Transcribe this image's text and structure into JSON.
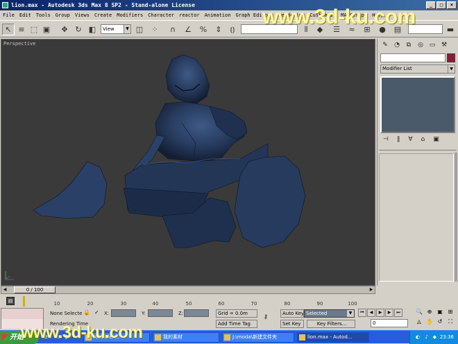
{
  "window": {
    "title": "lion.max - Autodesk 3ds Max 8 SP2 - Stand-alone License",
    "buttons": [
      "_",
      "□",
      "×"
    ]
  },
  "menu": [
    "File",
    "Edit",
    "Tools",
    "Group",
    "Views",
    "Create",
    "Modifiers",
    "Character",
    "reactor",
    "Animation",
    "Graph Editors",
    "Rendering",
    "Customize",
    "MAXScript",
    "Help"
  ],
  "toolbar": {
    "view_dropdown": "View",
    "icons": [
      "select-arrow-icon",
      "select-region-icon",
      "window-crossing-icon",
      "move-icon",
      "rotate-icon",
      "scale-icon",
      "pivot-icon",
      "mirror-icon",
      "align-icon",
      "snap-icon",
      "angle-snap-icon",
      "percent-snap-icon",
      "spinner-snap-icon",
      "named-selection-icon"
    ]
  },
  "viewport": {
    "label": "Perspective",
    "background": "#3a3a3a",
    "model_color": "#2a3a5a"
  },
  "command_panel": {
    "modifier_list": "Modifier List",
    "object_color": "#8c1a3a"
  },
  "time_slider": {
    "position": "0 / 100",
    "current_frame": 0,
    "total_frames": 100
  },
  "trackbar": {
    "ticks": [
      "10",
      "20",
      "30",
      "40",
      "50",
      "60",
      "70",
      "80",
      "90",
      "100"
    ]
  },
  "status": {
    "selection": "None Selecte",
    "rendering": "Rendering Time",
    "x_label": "X:",
    "y_label": "Y:",
    "z_label": "Z:",
    "grid": "Grid = 0.0m",
    "add_time_tag": "Add Time Tag",
    "auto_key": "Auto Key",
    "set_key": "Set Key",
    "selected": "Selected",
    "key_filters": "Key Filters...",
    "frame_value": "0"
  },
  "taskbar": {
    "start": "开始",
    "tasks": [
      {
        "label": "localFlex..."
      },
      {
        "label": "我的素材"
      },
      {
        "label": "J:\\moda\\新建文件夹"
      },
      {
        "label": "lion.max - Autod..."
      }
    ],
    "clock": "23:36"
  },
  "watermark": {
    "top": "www.3d-ku.com",
    "bottom": "www.3d-ku.com"
  }
}
